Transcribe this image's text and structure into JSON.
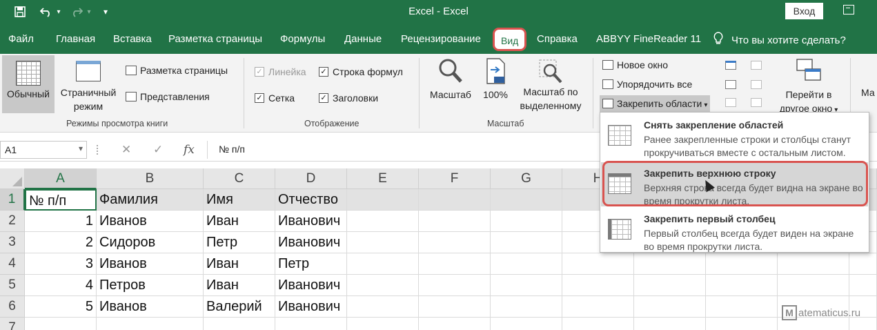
{
  "app_title": "Excel  -  Excel",
  "title_bar": {
    "save_icon": "save-icon",
    "undo_icon": "undo-icon",
    "redo_icon": "redo-icon",
    "customize_icon": "▾",
    "login_button": "Вход"
  },
  "tabs": [
    "Файл",
    "Главная",
    "Вставка",
    "Разметка страницы",
    "Формулы",
    "Данные",
    "Рецензирование",
    "Вид",
    "Справка",
    "ABBYY FineReader 11"
  ],
  "active_tab": "Вид",
  "tell_me": "Что вы хотите сделать?",
  "ribbon": {
    "views_group": {
      "label": "Режимы просмотра книги",
      "normal": "Обычный",
      "page_break_1": "Страничный",
      "page_break_2": "режим",
      "page_layout": "Разметка страницы",
      "custom_views": "Представления"
    },
    "show_group": {
      "label": "Отображение",
      "ruler": "Линейка",
      "formula_bar": "Строка формул",
      "gridlines": "Сетка",
      "headings": "Заголовки"
    },
    "zoom_group": {
      "label": "Масштаб",
      "zoom": "Масштаб",
      "zoom100": "100%",
      "zoom_sel_1": "Масштаб по",
      "zoom_sel_2": "выделенному"
    },
    "window_group": {
      "new_window": "Новое окно",
      "arrange_all": "Упорядочить все",
      "freeze_panes": "Закрепить области",
      "switch_1": "Перейти в",
      "switch_2": "другое окно",
      "macros": "Ма"
    }
  },
  "formula_bar": {
    "name_box": "A1",
    "cancel": "✕",
    "enter": "✓",
    "fx": "fx",
    "value": "№ п/п"
  },
  "columns": [
    "A",
    "B",
    "C",
    "D",
    "E",
    "F",
    "G",
    "H",
    "",
    "",
    "",
    ""
  ],
  "rows": [
    [
      "№ п/п",
      "Фамилия",
      "Имя",
      "Отчество"
    ],
    [
      "1",
      "Иванов",
      "Иван",
      "Иванович"
    ],
    [
      "2",
      "Сидоров",
      "Петр",
      "Иванович"
    ],
    [
      "3",
      "Иванов",
      "Иван",
      "Петр"
    ],
    [
      "4",
      "Петров",
      "Иван",
      "Иванович"
    ],
    [
      "5",
      "Иванов",
      "Валерий",
      "Иванович"
    ]
  ],
  "row_numbers": [
    "1",
    "2",
    "3",
    "4",
    "5",
    "6",
    "7"
  ],
  "freeze_menu": [
    {
      "title": "Снять закрепление областей",
      "desc": "Ранее закрепленные строки и столбцы станут прокручиваться вместе с остальным листом."
    },
    {
      "title": "Закрепить верхнюю строку",
      "desc": "Верхняя строка всегда будет видна на экране во время прокрутки листа."
    },
    {
      "title": "Закрепить первый столбец",
      "desc": "Первый столбец всегда будет виден на экране во время прокрутки листа."
    }
  ],
  "watermark": {
    "badge": "M",
    "text": "atematicus.ru"
  },
  "colors": {
    "excel_green": "#217346",
    "highlight_red": "#d9534f"
  }
}
